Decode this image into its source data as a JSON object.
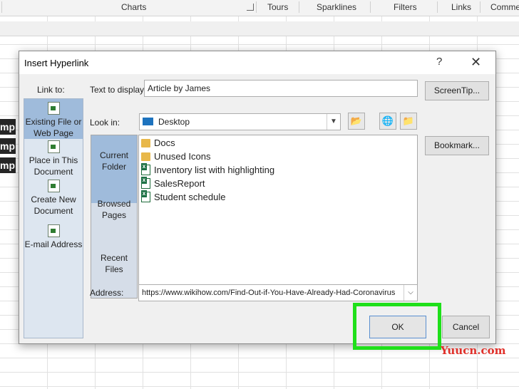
{
  "ribbon": {
    "groups": [
      "Charts",
      "Tours",
      "Sparklines",
      "Filters",
      "Links",
      "Commen"
    ]
  },
  "sheet": {
    "left_cell_texts": [
      "mple",
      "mple",
      "mple"
    ]
  },
  "dialog": {
    "title": "Insert Hyperlink",
    "help_glyph": "?",
    "close_glyph": "✕",
    "link_to_label": "Link to:",
    "link_to_items": [
      {
        "label_l1": "Existing File or",
        "label_l2": "Web Page",
        "icon": "web-page-icon"
      },
      {
        "label_l1": "Place in This",
        "label_l2": "Document",
        "icon": "place-in-document-icon"
      },
      {
        "label_l1": "Create New",
        "label_l2": "Document",
        "icon": "new-document-icon"
      },
      {
        "label_l1": "E-mail Address",
        "label_l2": "",
        "icon": "email-icon"
      }
    ],
    "text_to_display_label": "Text to display:",
    "text_to_display_value": "Article by James",
    "screentip_label": "ScreenTip...",
    "look_in_label": "Look in:",
    "look_in_value": "Desktop",
    "nav": [
      {
        "label_l1": "Current",
        "label_l2": "Folder"
      },
      {
        "label_l1": "Browsed",
        "label_l2": "Pages"
      },
      {
        "label_l1": "Recent Files",
        "label_l2": ""
      }
    ],
    "files": [
      {
        "name": "Docs",
        "type": "folder"
      },
      {
        "name": "Unused Icons",
        "type": "folder"
      },
      {
        "name": "Inventory list with highlighting",
        "type": "xls"
      },
      {
        "name": "SalesReport",
        "type": "xls"
      },
      {
        "name": "Student schedule",
        "type": "xls"
      }
    ],
    "bookmark_label": "Bookmark...",
    "address_label": "Address:",
    "address_value": "https://www.wikihow.com/Find-Out-if-You-Have-Already-Had-Coronavirus",
    "ok_label": "OK",
    "cancel_label": "Cancel"
  },
  "colors": {
    "highlight": "#1fe01a",
    "watermark": "#e0302a"
  },
  "watermark": "Yuucn.com"
}
